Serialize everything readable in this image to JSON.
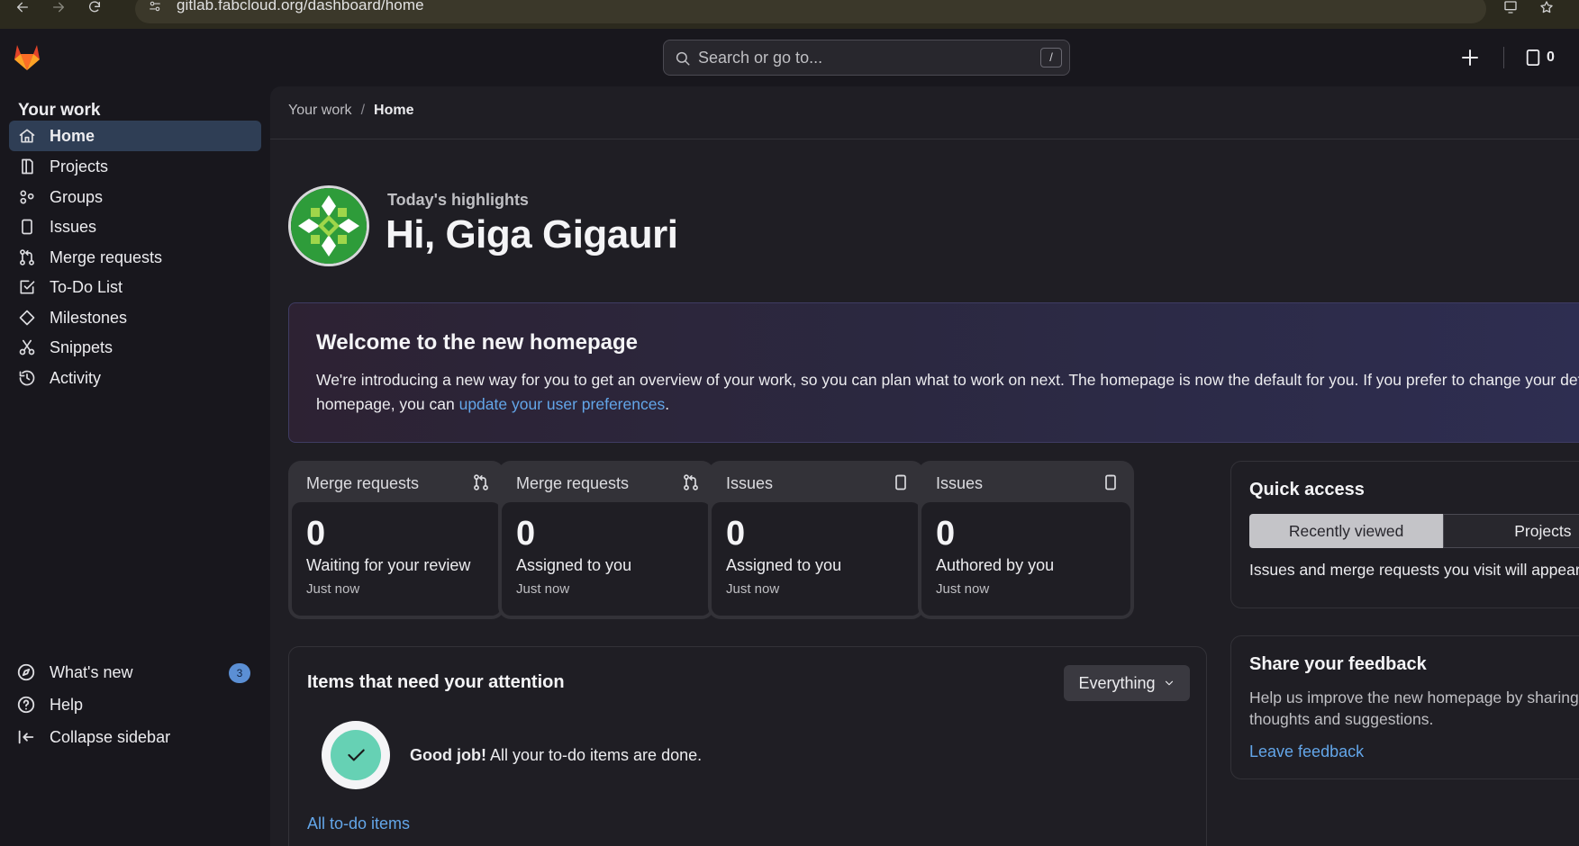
{
  "browser": {
    "url": "gitlab.fabcloud.org/dashboard/home"
  },
  "header": {
    "search_placeholder": "Search or go to...",
    "search_shortcut": "/",
    "todo_count": "0"
  },
  "sidebar": {
    "title": "Your work",
    "items": [
      {
        "label": "Home",
        "icon": "home-icon"
      },
      {
        "label": "Projects",
        "icon": "project-icon"
      },
      {
        "label": "Groups",
        "icon": "group-icon"
      },
      {
        "label": "Issues",
        "icon": "issues-icon"
      },
      {
        "label": "Merge requests",
        "icon": "merge-request-icon"
      },
      {
        "label": "To-Do List",
        "icon": "todo-icon"
      },
      {
        "label": "Milestones",
        "icon": "milestone-icon"
      },
      {
        "label": "Snippets",
        "icon": "snippet-icon"
      },
      {
        "label": "Activity",
        "icon": "history-icon"
      }
    ],
    "footer": {
      "whats_new": "What's new",
      "whats_new_badge": "3",
      "help": "Help",
      "collapse": "Collapse sidebar"
    }
  },
  "breadcrumb": {
    "parent": "Your work",
    "separator": "/",
    "current": "Home"
  },
  "hero": {
    "highlights_label": "Today's highlights",
    "greeting": "Hi, Giga Gigauri"
  },
  "welcome": {
    "title": "Welcome to the new homepage",
    "text_before": "We're introducing a new way for you to get an overview of your work, so you can plan what to work on next. The homepage is now the default for you. If you prefer to change your default homepage, you can ",
    "link": "update your user preferences",
    "text_after": "."
  },
  "stats": [
    {
      "heading": "Merge requests",
      "value": "0",
      "description": "Waiting for your review",
      "time": "Just now"
    },
    {
      "heading": "Merge requests",
      "value": "0",
      "description": "Assigned to you",
      "time": "Just now"
    },
    {
      "heading": "Issues",
      "value": "0",
      "description": "Assigned to you",
      "time": "Just now"
    },
    {
      "heading": "Issues",
      "value": "0",
      "description": "Authored by you",
      "time": "Just now"
    }
  ],
  "attention": {
    "title": "Items that need your attention",
    "filter": "Everything",
    "done_bold": "Good job!",
    "done_rest": " All your to-do items are done.",
    "link": "All to-do items"
  },
  "quick_access": {
    "title": "Quick access",
    "tabs": [
      "Recently viewed",
      "Projects"
    ],
    "text": "Issues and merge requests you visit will appear here."
  },
  "feedback": {
    "title": "Share your feedback",
    "text": "Help us improve the new homepage by sharing your thoughts and suggestions.",
    "link": "Leave feedback"
  },
  "colors": {
    "accent_link": "#63a6e9",
    "active_nav": "#2f3e55",
    "success": "#66d1b4",
    "badge": "#5b8fd4"
  }
}
